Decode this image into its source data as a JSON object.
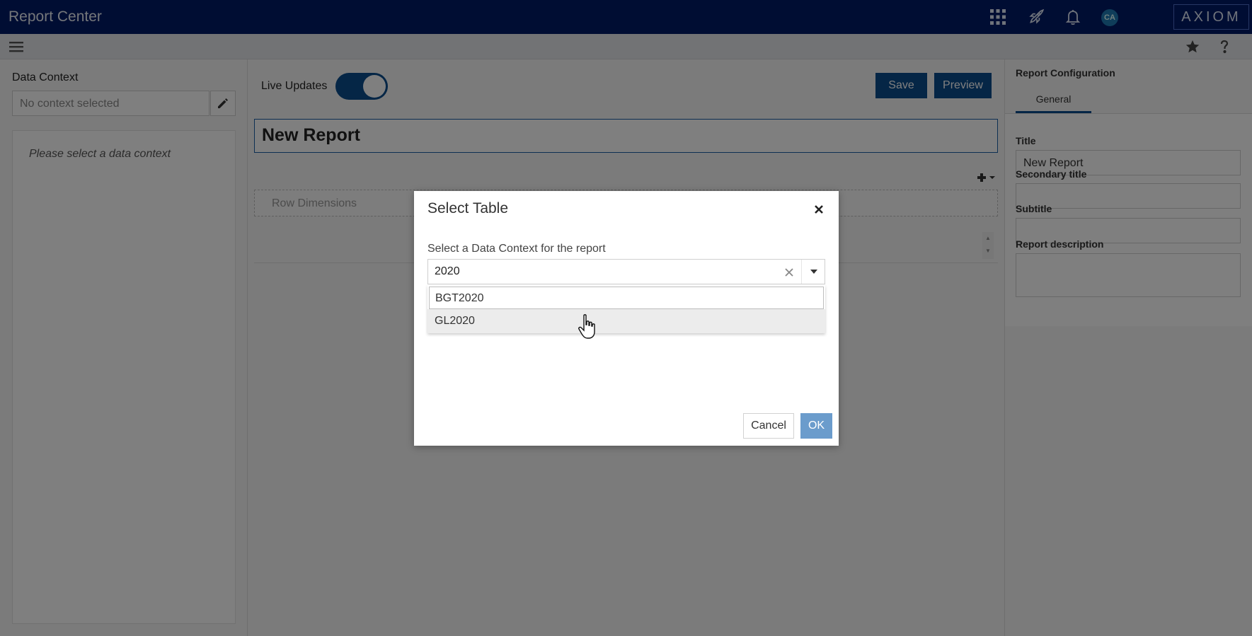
{
  "app": {
    "title": "Report Center",
    "brand": "AXIOM",
    "avatar_initials": "CA"
  },
  "icons": {
    "apps": "apps-grid-icon",
    "launch": "rocket-icon",
    "notifications": "bell-icon",
    "menu": "hamburger-menu-icon",
    "favorite": "star-icon",
    "help": "help-icon",
    "edit": "pencil-icon",
    "add": "plus-icon",
    "close": "close-icon",
    "clear": "clear-icon",
    "dropdown": "chevron-down-icon"
  },
  "colors": {
    "topbar": "#001a66",
    "primary": "#0b4c8c",
    "ok_button": "#6b9ccc"
  },
  "left_panel": {
    "label": "Data Context",
    "context_placeholder": "No context selected",
    "empty_message": "Please select a data context"
  },
  "center": {
    "live_updates_label": "Live Updates",
    "live_updates_on": true,
    "save_label": "Save",
    "preview_label": "Preview",
    "report_title": "New Report",
    "row_dimensions_label": "Row Dimensions"
  },
  "right_panel": {
    "header": "Report Configuration",
    "tab_general": "General",
    "title_label": "Title",
    "title_value": "New Report",
    "secondary_title_label": "Secondary title",
    "secondary_title_value": "",
    "subtitle_label": "Subtitle",
    "subtitle_value": "",
    "description_label": "Report description",
    "description_value": ""
  },
  "modal": {
    "title": "Select Table",
    "prompt": "Select a Data Context for the report",
    "search_value": "2020",
    "options": [
      "BGT2020",
      "GL2020"
    ],
    "cancel_label": "Cancel",
    "ok_label": "OK"
  }
}
